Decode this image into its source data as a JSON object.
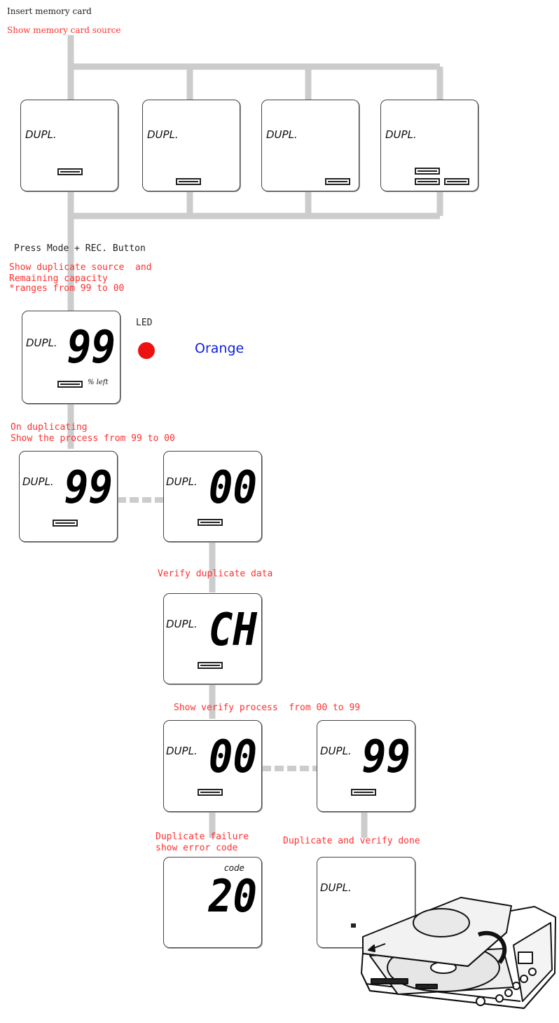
{
  "labels": {
    "insert_card": "Insert memory card",
    "show_source": "Show memory card source",
    "press_button": "Press Mode + REC. Button",
    "show_dup_source": "Show duplicate source  and",
    "remaining_capacity": "Remaining capacity",
    "ranges": "*ranges from 99 to 00",
    "led": "LED",
    "orange": "Orange",
    "on_duplicating": "On duplicating",
    "show_process": "Show the process from 99 to 00",
    "verify_data": "Verify duplicate data",
    "show_verify": "Show verify process  from 00 to 99",
    "dup_failure": "Duplicate failure",
    "show_error": "show error code",
    "dup_done": "Duplicate and verify done"
  },
  "display": {
    "dupl": "DUPL.",
    "pct_left": "% left",
    "code": "code",
    "v99": "99",
    "v00": "00",
    "vch": "CH",
    "v20": "20",
    "underscore": "_"
  },
  "colors": {
    "connector": "#cccccc",
    "annotation": "#ff3030",
    "led": "#ee1111",
    "orange_text": "#1020e0"
  }
}
